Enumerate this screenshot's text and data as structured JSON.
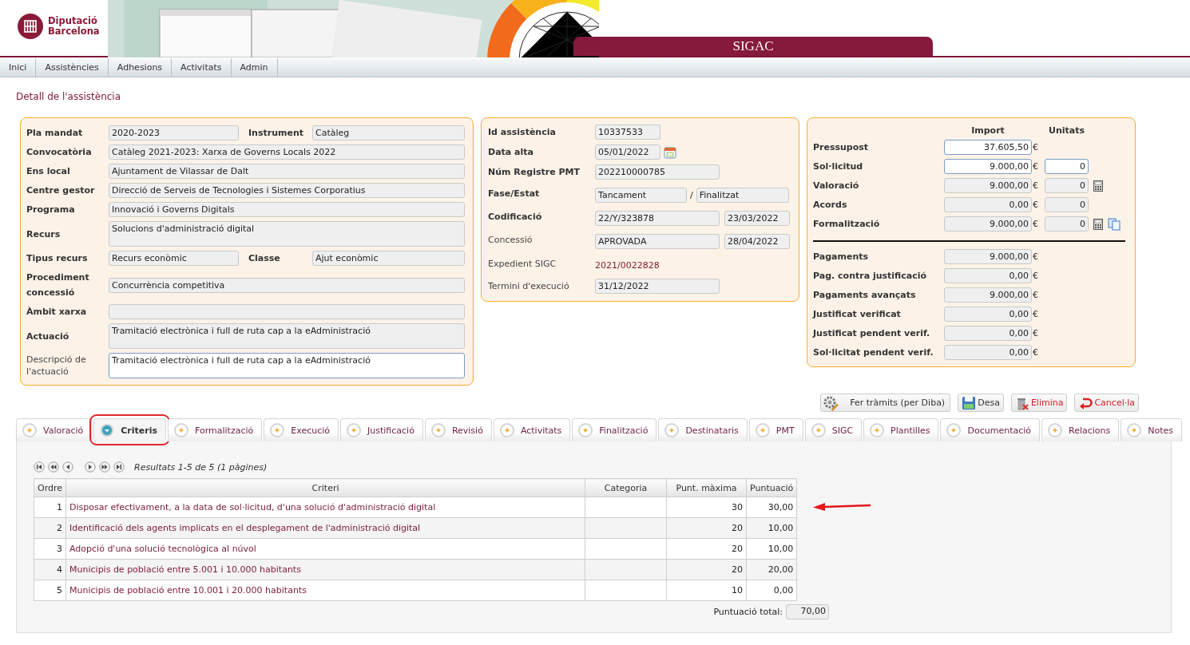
{
  "header": {
    "org_line1": "Diputació",
    "org_line2": "Barcelona",
    "app_title": "SIGAC"
  },
  "menu": [
    {
      "label": "Inici"
    },
    {
      "label": "Assistències"
    },
    {
      "label": "Adhesions"
    },
    {
      "label": "Activitats"
    },
    {
      "label": "Admin"
    }
  ],
  "page_title": "Detall de l'assistència",
  "general": [
    {
      "kind": "pair",
      "label": "Pla mandat",
      "required": true,
      "value": "2020-2023",
      "label2": "Instrument",
      "value2": "Catàleg"
    },
    {
      "kind": "single",
      "label": "Convocatòria",
      "required": true,
      "value": "Catàleg 2021-2023: Xarxa de Governs Locals 2022"
    },
    {
      "kind": "single",
      "label": "Ens local",
      "required": true,
      "value": "Ajuntament de Vilassar de Dalt"
    },
    {
      "kind": "single",
      "label": "Centre gestor",
      "required": true,
      "value": "Direcció de Serveis de Tecnologies i Sistemes Corporatius"
    },
    {
      "kind": "single",
      "label": "Programa",
      "required": true,
      "value": "Innovació i Governs Digitals"
    },
    {
      "kind": "area",
      "label": "Recurs",
      "required": true,
      "value": "Solucions d'administració digital",
      "editable": false
    },
    {
      "kind": "pair",
      "label": "Tipus recurs",
      "required": true,
      "value": "Recurs econòmic",
      "label2": "Classe",
      "value2": "Ajut econòmic"
    },
    {
      "kind": "single",
      "label": "Procediment concessió",
      "required": true,
      "value": "Concurrència competitiva"
    },
    {
      "kind": "single",
      "label": "Àmbit xarxa",
      "required": true
    },
    {
      "kind": "area",
      "label": "Actuació",
      "required": true,
      "value": "Tramitació electrònica i full de ruta cap a la eAdministració",
      "editable": false
    },
    {
      "kind": "area",
      "label": "Descripció de l'actuació",
      "required": false,
      "value": "Tramitació electrònica i full de ruta cap a la eAdministració",
      "editable": true
    }
  ],
  "record": [
    {
      "kind": "field",
      "label": "Id assistència",
      "required": true,
      "values": [
        "10337533"
      ]
    },
    {
      "kind": "date",
      "label": "Data alta",
      "required": true,
      "values": [
        "05/01/2022"
      ]
    },
    {
      "kind": "field",
      "label": "Núm Registre PMT",
      "required": true,
      "values": [
        "202210000785"
      ]
    },
    {
      "kind": "split",
      "label": "Fase/Estat",
      "required": true,
      "values": [
        "Tancament",
        "Finalitzat"
      ],
      "separator": "/"
    },
    {
      "kind": "split",
      "label": "Codificació",
      "required": true,
      "values": [
        "22/Y/323878",
        "23/03/2022"
      ]
    },
    {
      "kind": "split",
      "label": "Concessió",
      "required": false,
      "values": [
        "APROVADA",
        "28/04/2022"
      ]
    },
    {
      "kind": "text",
      "label": "Expedient SIGC",
      "required": false,
      "values": [
        "2021/0022828"
      ]
    },
    {
      "kind": "field",
      "label": "Termini d'execució",
      "required": false,
      "values": [
        "31/12/2022"
      ]
    }
  ],
  "amounts": {
    "columns": [
      "Import",
      "Unitats"
    ],
    "rows": [
      {
        "label": "Pressupost",
        "import": "37.605,50",
        "currency": "€",
        "import_editable": true,
        "calculator": false,
        "copy": false
      },
      {
        "label": "Sol·licitud",
        "import": "9.000,00",
        "currency": "€",
        "import_editable": true,
        "units": "0",
        "units_editable": true,
        "calculator": false,
        "copy": false
      },
      {
        "label": "Valoració",
        "import": "9.000,00",
        "currency": "€",
        "import_editable": false,
        "units": "0",
        "units_editable": false,
        "calculator": true,
        "copy": false
      },
      {
        "label": "Acords",
        "import": "0,00",
        "currency": "€",
        "import_editable": false,
        "units": "0",
        "units_editable": false,
        "calculator": false,
        "copy": false
      },
      {
        "label": "Formalització",
        "import": "9.000,00",
        "currency": "€",
        "import_editable": false,
        "units": "0",
        "units_editable": false,
        "calculator": true,
        "copy": true
      }
    ],
    "payments": [
      {
        "label": "Pagaments",
        "import": "9.000,00",
        "currency": "€"
      },
      {
        "label": "Pag. contra justificació",
        "import": "0,00",
        "currency": "€"
      },
      {
        "label": "Pagaments avançats",
        "import": "9.000,00",
        "currency": "€"
      },
      {
        "label": "Justificat verificat",
        "import": "0,00",
        "currency": "€"
      },
      {
        "label": "Justificat pendent verif.",
        "import": "0,00",
        "currency": "€"
      },
      {
        "label": "Sol·licitat pendent verif.",
        "import": "0,00",
        "currency": "€"
      }
    ]
  },
  "actions": [
    {
      "kind": "process",
      "label": "Fer tràmits (per Diba)"
    },
    {
      "kind": "save",
      "label": "Desa"
    },
    {
      "kind": "delete",
      "label": "Elimina"
    },
    {
      "kind": "cancel",
      "label": "Cancel·la"
    }
  ],
  "tabs": [
    {
      "label": "Valoració",
      "selected": false,
      "highlighted": false
    },
    {
      "label": "Criteris",
      "selected": true,
      "highlighted": true
    },
    {
      "label": "Formalització",
      "selected": false,
      "highlighted": false
    },
    {
      "label": "Execució",
      "selected": false,
      "highlighted": false
    },
    {
      "label": "Justificació",
      "selected": false,
      "highlighted": false
    },
    {
      "label": "Revisió",
      "selected": false,
      "highlighted": false
    },
    {
      "label": "Activitats",
      "selected": false,
      "highlighted": false
    },
    {
      "label": "Finalització",
      "selected": false,
      "highlighted": false
    },
    {
      "label": "Destinataris",
      "selected": false,
      "highlighted": false
    },
    {
      "label": "PMT",
      "selected": false,
      "highlighted": false
    },
    {
      "label": "SIGC",
      "selected": false,
      "highlighted": false
    },
    {
      "label": "Plantilles",
      "selected": false,
      "highlighted": false
    },
    {
      "label": "Documentació",
      "selected": false,
      "highlighted": false
    },
    {
      "label": "Relacions",
      "selected": false,
      "highlighted": false
    },
    {
      "label": "Notes",
      "selected": false,
      "highlighted": false
    }
  ],
  "pager": {
    "summary": "Resultats 1-5 de 5 (1 pàgines)"
  },
  "table": {
    "columns": [
      "Ordre",
      "Criteri",
      "Categoria",
      "Punt. màxima",
      "Puntuació"
    ],
    "rows": [
      {
        "order": "1",
        "criterion": "Disposar efectivament, a la data de sol·licitud, d'una solució d'administració digital",
        "max": "30",
        "score": "30,00",
        "pointed": true
      },
      {
        "order": "2",
        "criterion": "Identificació dels agents implicats en el desplegament de l'administració digital",
        "max": "20",
        "score": "10,00",
        "pointed": false
      },
      {
        "order": "3",
        "criterion": "Adopció d'una solució tecnològica al núvol",
        "max": "20",
        "score": "10,00",
        "pointed": false
      },
      {
        "order": "4",
        "criterion": "Municipis de població entre 5.001 i 10.000 habitants",
        "max": "20",
        "score": "20,00",
        "pointed": false
      },
      {
        "order": "5",
        "criterion": "Municipis de població entre 10.001 i 20.000 habitants",
        "max": "10",
        "score": "0,00",
        "pointed": false
      }
    ],
    "total_label": "Puntuació total:",
    "total": "70,00"
  }
}
